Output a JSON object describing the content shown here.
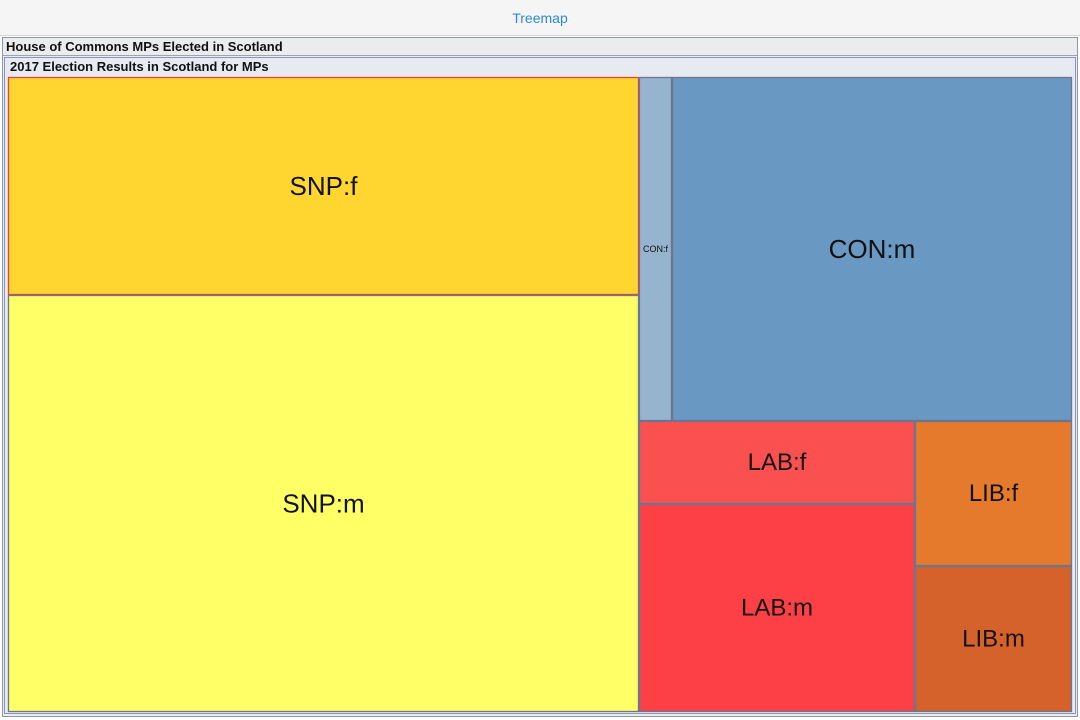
{
  "toolbar": {
    "tab_label": "Treemap"
  },
  "panel": {
    "outer_title": "House of Commons MPs Elected in Scotland",
    "inner_title": "2017 Election Results in Scotland for MPs"
  },
  "chart_data": {
    "type": "treemap",
    "title": "2017 Election Results in Scotland for MPs",
    "tiles": [
      {
        "id": "snp-f",
        "label": "SNP:f",
        "party": "SNP",
        "gender": "f",
        "value": 12,
        "color": "#ffd630"
      },
      {
        "id": "snp-m",
        "label": "SNP:m",
        "party": "SNP",
        "gender": "m",
        "value": 23,
        "color": "#ffff66"
      },
      {
        "id": "con-f",
        "label": "CON:f",
        "party": "CON",
        "gender": "f",
        "value": 1,
        "color": "#96b4cf"
      },
      {
        "id": "con-m",
        "label": "CON:m",
        "party": "CON",
        "gender": "m",
        "value": 12,
        "color": "#6998c2"
      },
      {
        "id": "lab-f",
        "label": "LAB:f",
        "party": "LAB",
        "gender": "f",
        "value": 2,
        "color": "#fa5050"
      },
      {
        "id": "lab-m",
        "label": "LAB:m",
        "party": "LAB",
        "gender": "m",
        "value": 5,
        "color": "#fc4046"
      },
      {
        "id": "lib-f",
        "label": "LIB:f",
        "party": "LIB",
        "gender": "f",
        "value": 2,
        "color": "#e57a2d"
      },
      {
        "id": "lib-m",
        "label": "LIB:m",
        "party": "LIB",
        "gender": "m",
        "value": 2,
        "color": "#d5622b"
      }
    ]
  }
}
